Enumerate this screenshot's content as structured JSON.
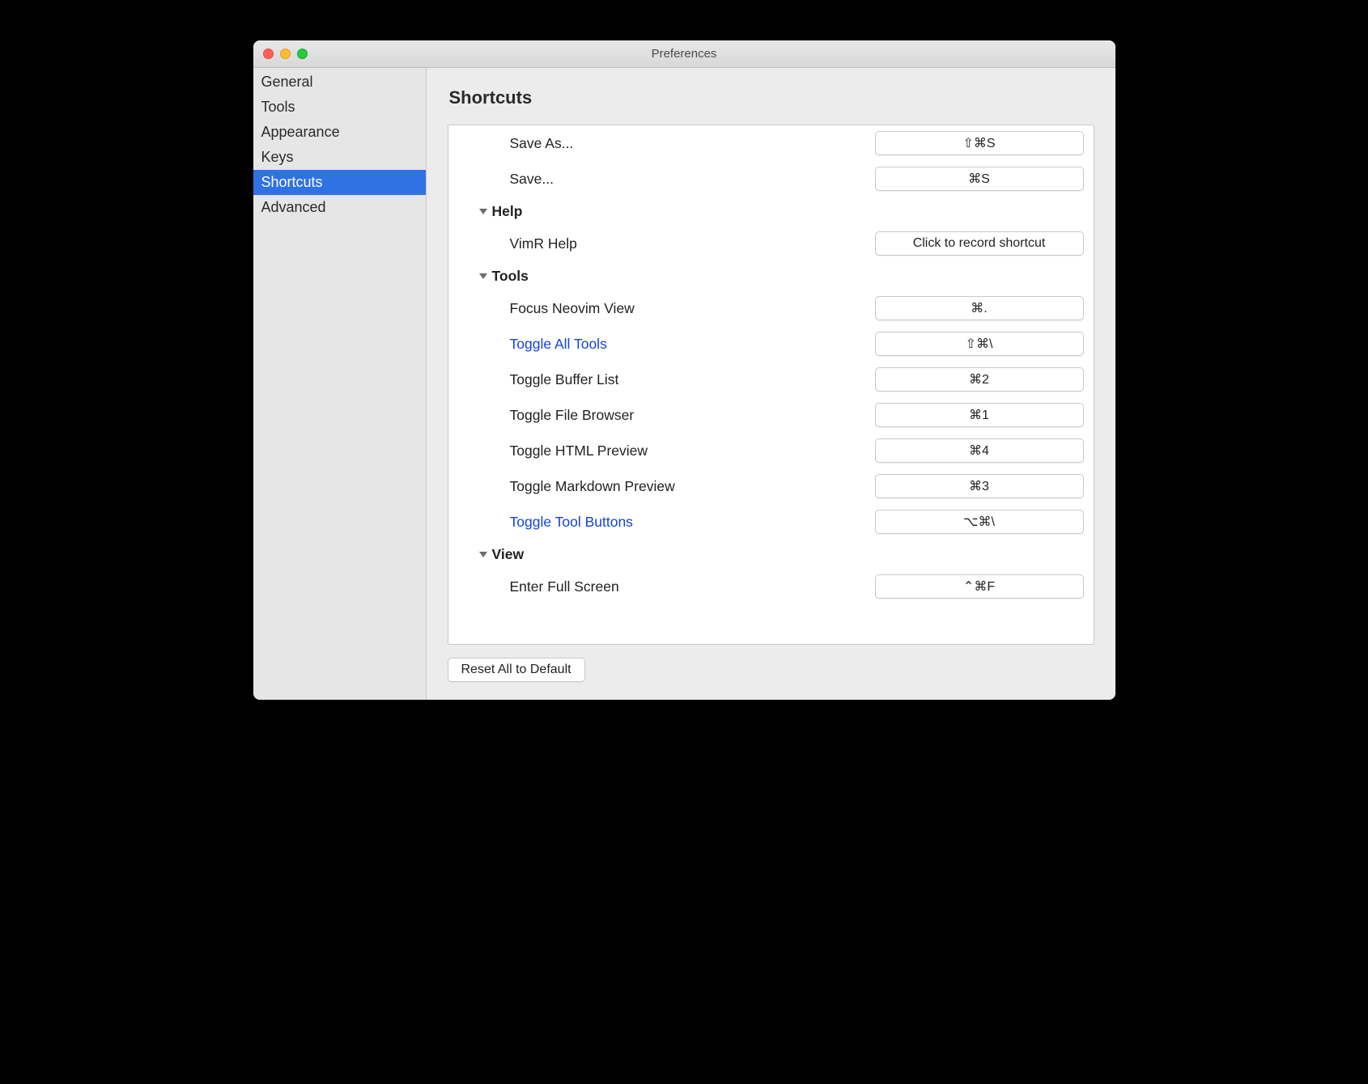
{
  "window": {
    "title": "Preferences"
  },
  "sidebar": {
    "items": [
      {
        "label": "General",
        "selected": false
      },
      {
        "label": "Tools",
        "selected": false
      },
      {
        "label": "Appearance",
        "selected": false
      },
      {
        "label": "Keys",
        "selected": false
      },
      {
        "label": "Shortcuts",
        "selected": true
      },
      {
        "label": "Advanced",
        "selected": false
      }
    ]
  },
  "main": {
    "header": "Shortcuts",
    "reset_label": "Reset All to Default",
    "record_placeholder": "Click to record shortcut",
    "rows": [
      {
        "type": "item",
        "label": "Save As...",
        "shortcut": "⇧⌘S",
        "modified": false
      },
      {
        "type": "item",
        "label": "Save...",
        "shortcut": "⌘S",
        "modified": false
      },
      {
        "type": "group",
        "label": "Help"
      },
      {
        "type": "item",
        "label": "VimR Help",
        "shortcut": null,
        "modified": false
      },
      {
        "type": "group",
        "label": "Tools"
      },
      {
        "type": "item",
        "label": "Focus Neovim View",
        "shortcut": "⌘.",
        "modified": false
      },
      {
        "type": "item",
        "label": "Toggle All Tools",
        "shortcut": "⇧⌘\\",
        "modified": true
      },
      {
        "type": "item",
        "label": "Toggle Buffer List",
        "shortcut": "⌘2",
        "modified": false
      },
      {
        "type": "item",
        "label": "Toggle File Browser",
        "shortcut": "⌘1",
        "modified": false
      },
      {
        "type": "item",
        "label": "Toggle HTML Preview",
        "shortcut": "⌘4",
        "modified": false
      },
      {
        "type": "item",
        "label": "Toggle Markdown Preview",
        "shortcut": "⌘3",
        "modified": false
      },
      {
        "type": "item",
        "label": "Toggle Tool Buttons",
        "shortcut": "⌥⌘\\",
        "modified": true
      },
      {
        "type": "group",
        "label": "View"
      },
      {
        "type": "item",
        "label": "Enter Full Screen",
        "shortcut": "⌃⌘F",
        "modified": false
      }
    ]
  }
}
